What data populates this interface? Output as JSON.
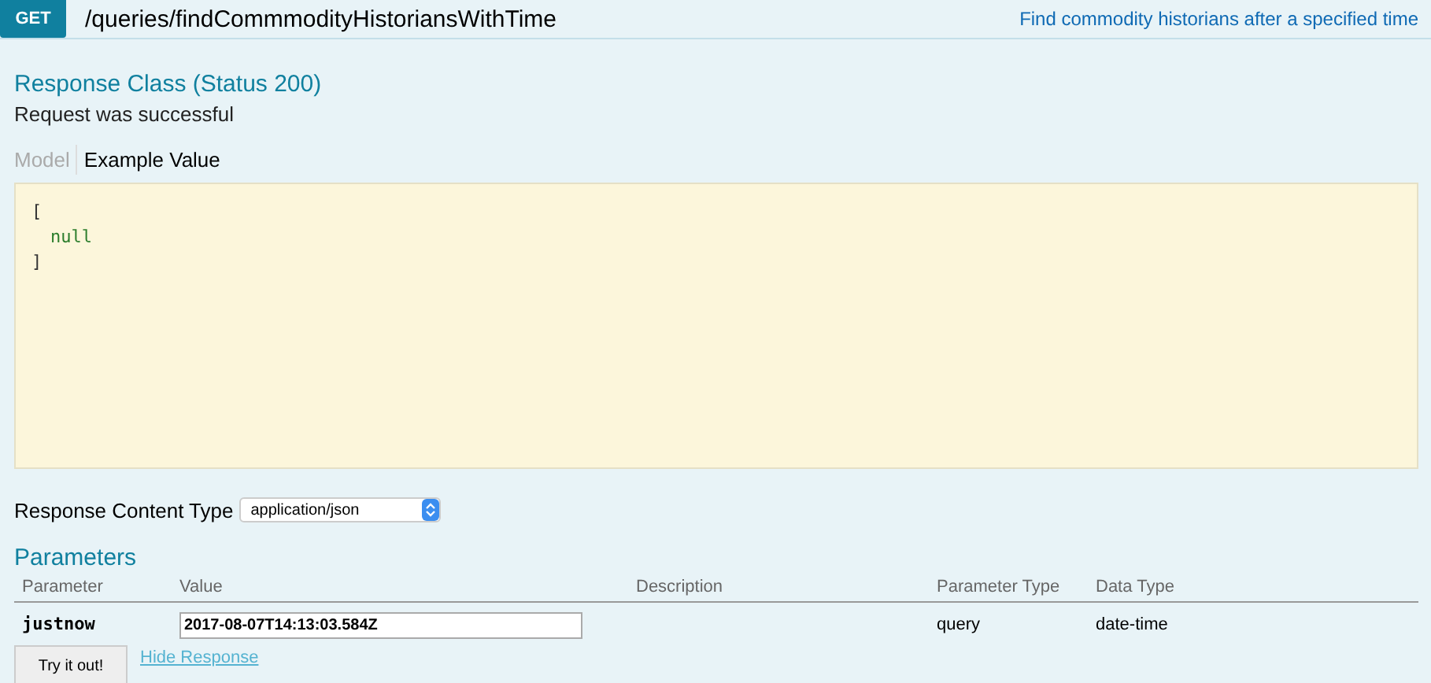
{
  "operation": {
    "method": "GET",
    "path": "/queries/findCommmodityHistoriansWithTime",
    "summary": "Find commodity historians after a specified time"
  },
  "response_class": {
    "title": "Response Class (Status 200)",
    "message": "Request was successful"
  },
  "tabs": [
    {
      "label": "Model",
      "selected": false
    },
    {
      "label": "Example Value",
      "selected": true
    }
  ],
  "example": [
    {
      "kind": "punct",
      "text": "["
    },
    {
      "kind": "literal",
      "text": "null"
    },
    {
      "kind": "punct",
      "text": "]"
    }
  ],
  "content_type": {
    "label": "Response Content Type",
    "value": "application/json"
  },
  "parameters": {
    "title": "Parameters",
    "columns": [
      "Parameter",
      "Value",
      "Description",
      "Parameter Type",
      "Data Type"
    ],
    "rows": [
      {
        "name": "justnow",
        "value": "2017-08-07T14:13:03.584Z",
        "parameter_type": "query",
        "data_type": "date-time"
      }
    ]
  },
  "actions": {
    "button": "Try it out!",
    "link": "Hide Response"
  }
}
